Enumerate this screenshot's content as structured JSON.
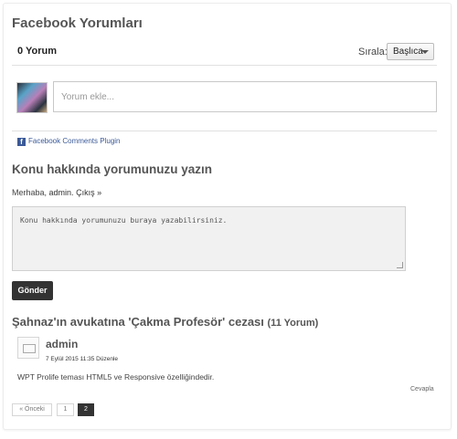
{
  "facebook": {
    "title": "Facebook Yorumları",
    "count_label": "0 Yorum",
    "sort_label": "Sırala:",
    "sort_value": "Başlıca",
    "input_placeholder": "Yorum ekle...",
    "plugin_label": "Facebook Comments Plugin"
  },
  "reply": {
    "title": "Konu hakkında yorumunuzu yazın",
    "greeting": "Merhaba,",
    "user": "admin.",
    "logout": "Çıkış »",
    "textarea_placeholder": "Konu hakkında yorumunuzu buraya yazabilirsiniz.",
    "submit_label": "Gönder"
  },
  "comments": {
    "post_title": "Şahnaz'ın avukatına 'Çakma Profesör' cezası",
    "count": "(11 Yorum)",
    "items": [
      {
        "author": "admin",
        "date": "7 Eylül 2015 11:35 Düzenle",
        "text": "WPT Prolife teması HTML5 ve Responsive özelliğindedir.",
        "reply_label": "Cevapla"
      }
    ]
  },
  "pagination": {
    "prev_label": "« Önceki",
    "pages": [
      "1",
      "2"
    ],
    "current": "2"
  }
}
